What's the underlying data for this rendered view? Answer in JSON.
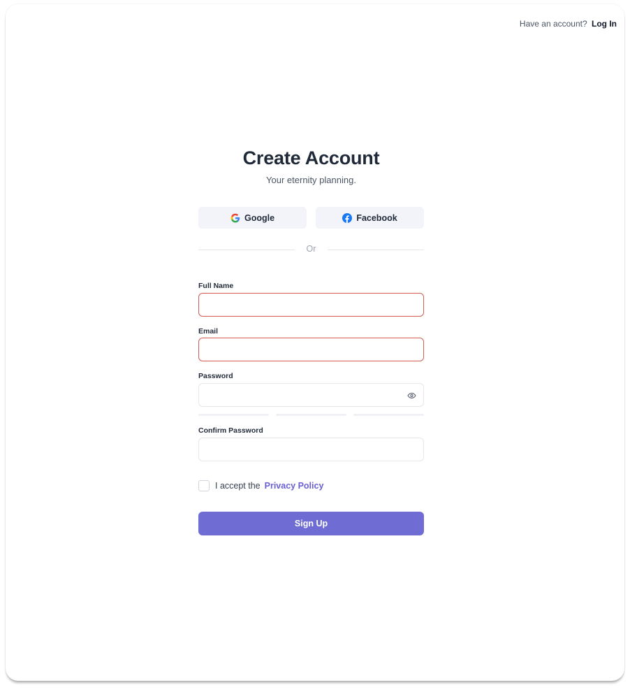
{
  "header": {
    "prompt": "Have an account?",
    "login_label": "Log In"
  },
  "title": "Create Account",
  "subtitle": "Your eternity planning.",
  "social": {
    "google_label": "Google",
    "facebook_label": "Facebook"
  },
  "divider_text": "Or",
  "fields": {
    "full_name_label": "Full Name",
    "full_name_value": "",
    "email_label": "Email",
    "email_value": "",
    "password_label": "Password",
    "password_value": "",
    "confirm_password_label": "Confirm Password",
    "confirm_password_value": ""
  },
  "terms": {
    "prefix": "I accept the",
    "link": "Privacy Policy",
    "checked": false
  },
  "submit_label": "Sign Up",
  "colors": {
    "accent": "#6f6dd4",
    "link": "#6b5fd3",
    "error_border": "#d45a50",
    "social_bg": "#f3f4fa"
  },
  "icons": {
    "google": "google-icon",
    "facebook": "facebook-icon",
    "password_toggle": "eye-icon"
  }
}
